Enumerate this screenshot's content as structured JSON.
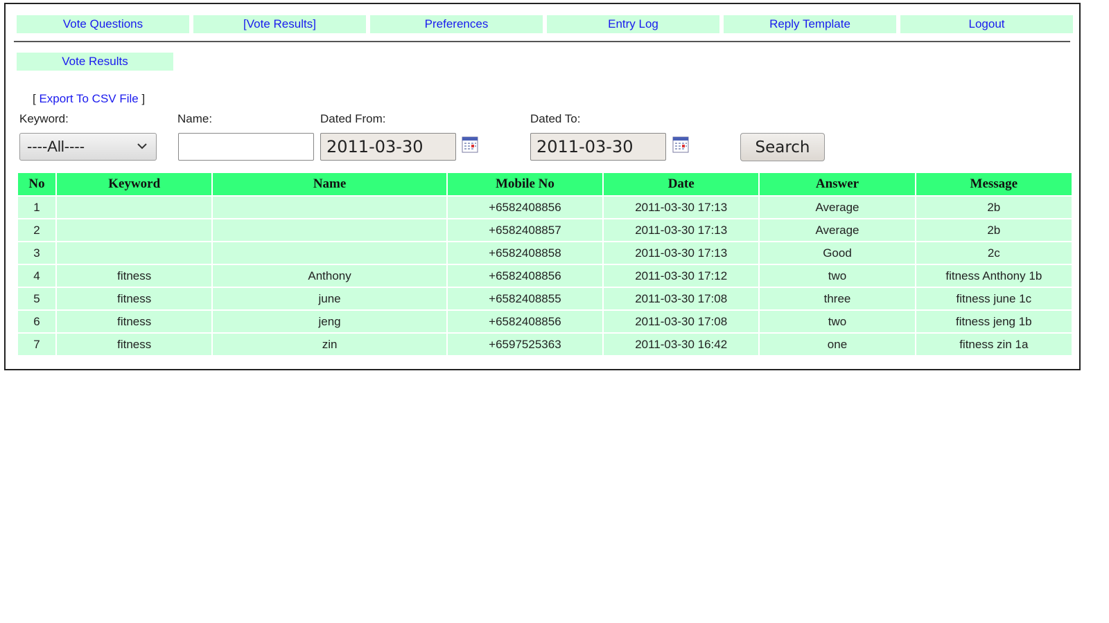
{
  "nav": {
    "items": [
      {
        "label": "Vote Questions"
      },
      {
        "label": "[Vote Results]"
      },
      {
        "label": "Preferences"
      },
      {
        "label": "Entry Log"
      },
      {
        "label": "Reply Template"
      },
      {
        "label": "Logout"
      }
    ]
  },
  "subnav": {
    "label": "Vote Results"
  },
  "export": {
    "open": "[ ",
    "link": "Export To CSV File",
    "close": " ]"
  },
  "filters": {
    "keyword_label": "Keyword:",
    "keyword_value": "----All----",
    "name_label": "Name:",
    "name_value": "",
    "from_label": "Dated From:",
    "from_value": "2011-03-30",
    "to_label": "Dated To:",
    "to_value": "2011-03-30",
    "search_label": "Search"
  },
  "table": {
    "headers": [
      "No",
      "Keyword",
      "Name",
      "Mobile No",
      "Date",
      "Answer",
      "Message"
    ],
    "rows": [
      [
        "1",
        "",
        "",
        "+6582408856",
        "2011-03-30 17:13",
        "Average",
        "2b"
      ],
      [
        "2",
        "",
        "",
        "+6582408857",
        "2011-03-30 17:13",
        "Average",
        "2b"
      ],
      [
        "3",
        "",
        "",
        "+6582408858",
        "2011-03-30 17:13",
        "Good",
        "2c"
      ],
      [
        "4",
        "fitness",
        "Anthony",
        "+6582408856",
        "2011-03-30 17:12",
        "two",
        "fitness Anthony 1b"
      ],
      [
        "5",
        "fitness",
        "june",
        "+6582408855",
        "2011-03-30 17:08",
        "three",
        "fitness june 1c"
      ],
      [
        "6",
        "fitness",
        "jeng",
        "+6582408856",
        "2011-03-30 17:08",
        "two",
        "fitness jeng 1b"
      ],
      [
        "7",
        "fitness",
        "zin",
        "+6597525363",
        "2011-03-30 16:42",
        "one",
        "fitness zin 1a"
      ]
    ]
  },
  "colors": {
    "nav_bg": "#ccffdd",
    "link": "#1a1aee",
    "header_bg": "#33ff7a",
    "row_bg": "#ccffdd"
  },
  "icons": {
    "select_arrow": "chevron-down-icon",
    "date_picker": "calendar-icon"
  }
}
